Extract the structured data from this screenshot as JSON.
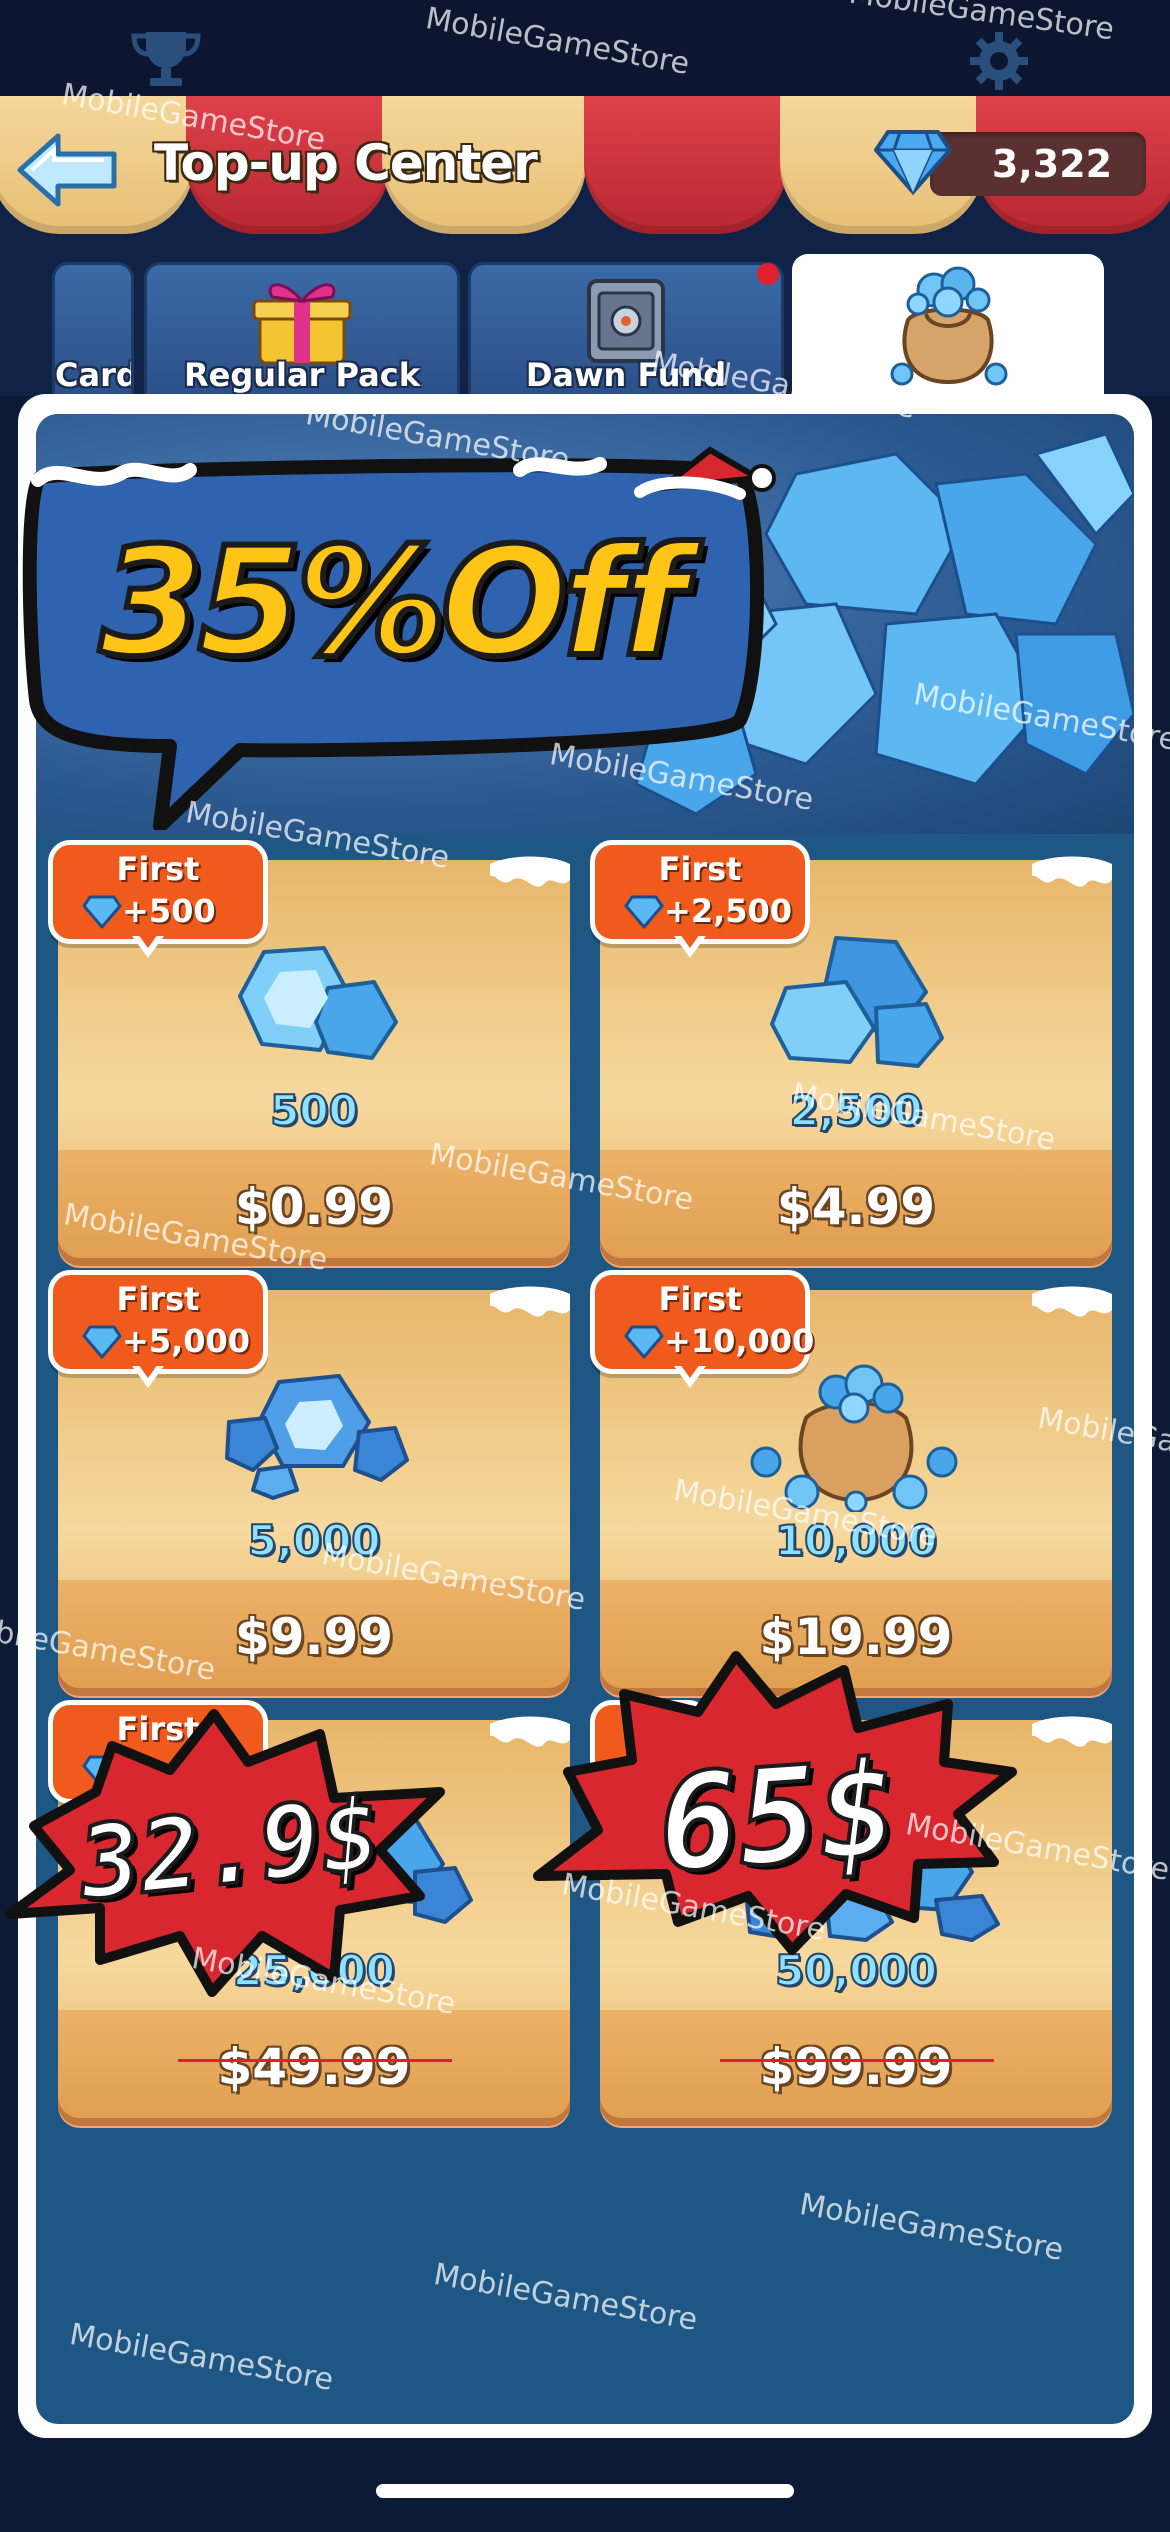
{
  "status": {
    "trophy_icon": "trophy-icon",
    "gear_icon": "gear-icon"
  },
  "header": {
    "title": "Top-up Center",
    "currency_value": "3,322",
    "currency_icon": "diamond-icon",
    "back_icon": "back-arrow-icon"
  },
  "tabs": [
    {
      "label": "Cards",
      "icon": "cards-icon"
    },
    {
      "label": "Regular Pack",
      "icon": "gift-box-icon"
    },
    {
      "label": "Dawn Fund",
      "icon": "safe-icon",
      "notification": true
    },
    {
      "label": "",
      "icon": "gem-sack-icon",
      "active": true
    }
  ],
  "banner": {
    "discount_text": "35%Off"
  },
  "products": [
    {
      "badge_title": "First",
      "badge_bonus": "+500",
      "amount": "500",
      "price": "$0.99",
      "struck": false
    },
    {
      "badge_title": "First",
      "badge_bonus": "+2,500",
      "amount": "2,500",
      "price": "$4.99",
      "struck": false
    },
    {
      "badge_title": "First",
      "badge_bonus": "+5,000",
      "amount": "5,000",
      "price": "$9.99",
      "struck": false
    },
    {
      "badge_title": "First",
      "badge_bonus": "+10,000",
      "amount": "10,000",
      "price": "$19.99",
      "struck": false
    },
    {
      "badge_title": "First",
      "badge_bonus": "",
      "amount": "25,000",
      "price": "$49.99",
      "struck": true
    },
    {
      "badge_title": "",
      "badge_bonus": "",
      "amount": "50,000",
      "price": "$99.99",
      "struck": true
    }
  ],
  "promos": [
    {
      "text": "32.9$"
    },
    {
      "text": "65$"
    }
  ],
  "watermark": "MobileGameStore",
  "colors": {
    "accent_orange": "#f05a1c",
    "discount_yellow": "#ffc516",
    "promo_red": "#d9272f",
    "gem_blue": "#8fe2ff"
  }
}
